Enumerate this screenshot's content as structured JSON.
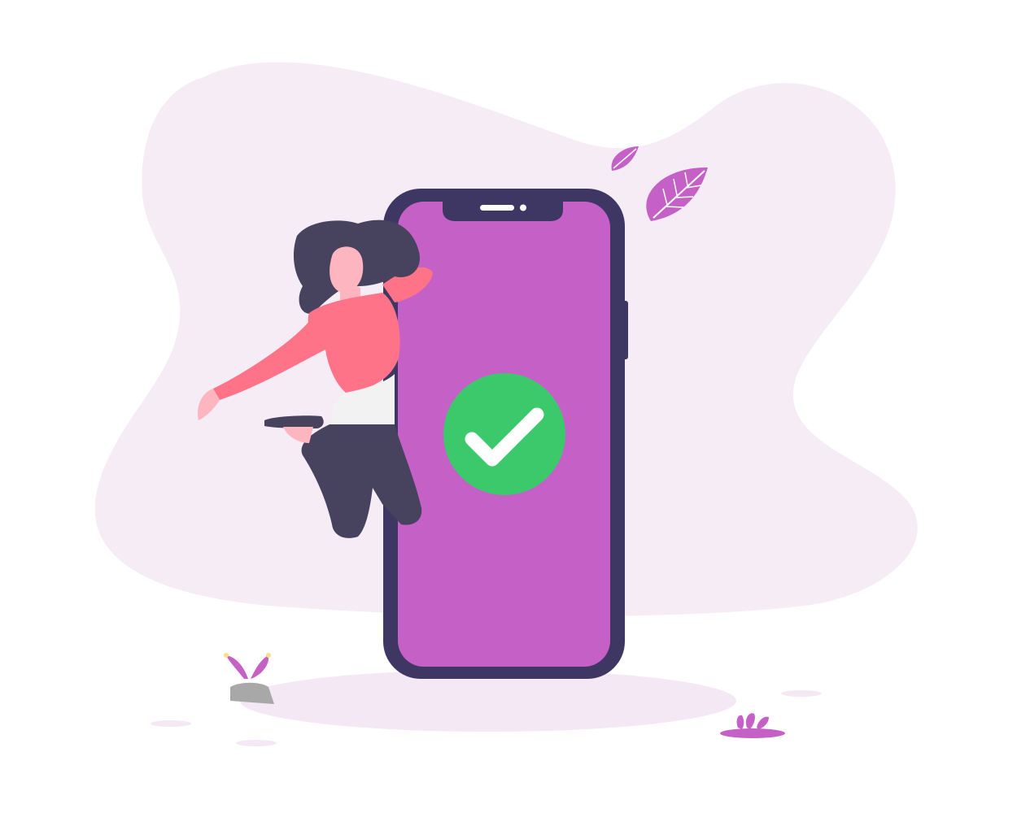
{
  "illustration": {
    "subject": "woman-jumping-beside-phone-with-success-checkmark",
    "icons": [
      "checkmark-icon",
      "leaf-icon",
      "plant-icon",
      "flower-icon",
      "rock-icon"
    ]
  },
  "colors": {
    "background_blob": "#f5ecf6",
    "ground_shadow": "#f3e8f4",
    "phone_frame": "#3f3763",
    "phone_screen": "#c561c6",
    "notch": "#3f3763",
    "check_circle": "#3bc96b",
    "check_mark": "#ffffff",
    "shirt": "#ff7389",
    "pants": "#47425d",
    "hair": "#47425d",
    "skin": "#fdb5c0",
    "leaf": "#c561c6",
    "rock": "#a8a8a8"
  }
}
